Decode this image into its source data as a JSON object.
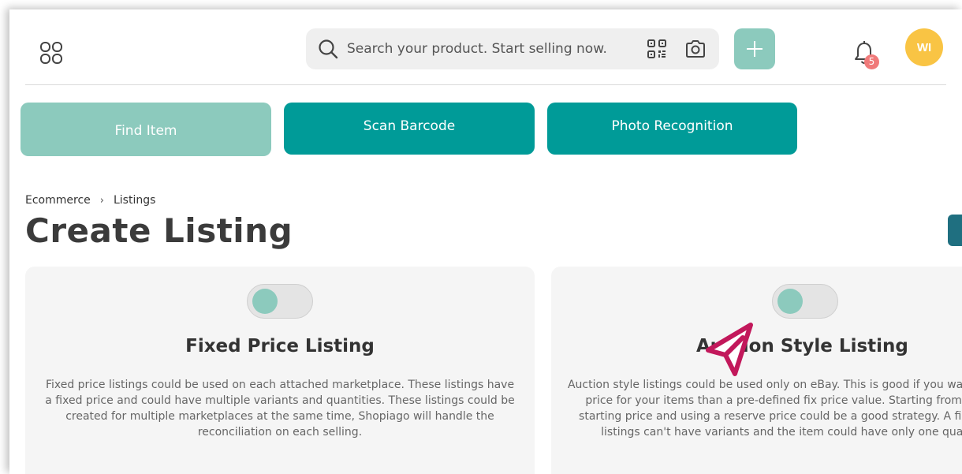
{
  "header": {
    "search": {
      "placeholder": "Search your product. Start selling now."
    },
    "notifications": {
      "count": "5"
    },
    "avatar": {
      "initials": "WI"
    }
  },
  "modes": [
    {
      "label": "Find Item",
      "active": true
    },
    {
      "label": "Scan Barcode",
      "active": false
    },
    {
      "label": "Photo Recognition",
      "active": false
    }
  ],
  "breadcrumb": {
    "root": "Ecommerce",
    "current": "Listings"
  },
  "page": {
    "title": "Create Listing"
  },
  "cards": [
    {
      "title": "Fixed Price Listing",
      "description": "Fixed price listings could be used on each attached marketplace. These listings have a fixed price and could have multiple variants and quantities. These listings could be created for multiple marketplaces at the same time, Shopiago will handle the reconciliation on each selling."
    },
    {
      "title": "Auction Style Listing",
      "description": "Auction style listings could be used only on eBay. This is good if you want a higher price for your items than a pre-defined fix price value. Starting from a lower starting price and using a reserve price could be a good strategy. A fixed price listings can't have variants and the item could have only one quantity."
    }
  ],
  "colors": {
    "accent": "#009b98",
    "accent_light": "#8ccabd",
    "avatar": "#f9c444",
    "badge": "#f07a7a",
    "cursor": "#c2185b"
  },
  "icons": [
    "grid-icon",
    "search-icon",
    "qr-code-icon",
    "camera-icon",
    "plus-icon",
    "bell-icon",
    "cursor-pointer-icon"
  ]
}
